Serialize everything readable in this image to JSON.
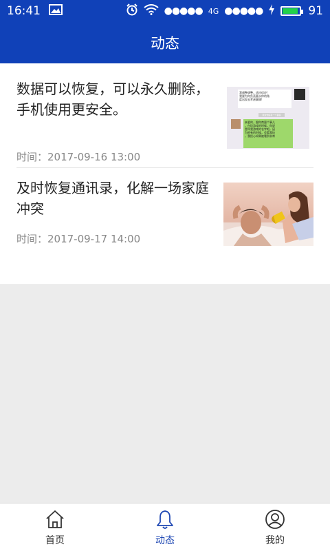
{
  "status_bar": {
    "time": "16:41",
    "network": "4G",
    "battery": "91",
    "battery_level": 0.91,
    "icons": [
      "image-icon",
      "alarm-icon",
      "wifi-icon",
      "signal-icon",
      "charging-icon",
      "battery-icon"
    ]
  },
  "header": {
    "title": "动态"
  },
  "feed": {
    "items": [
      {
        "title": "数据可以恢复，可以永久删除，手机使用更安全。",
        "time": "时间：2017-09-16 13:00",
        "thumb": {
          "bubble_top": "我调整调整，适应适应!\n我要为你负责要从你的角\n度出发去考虑事情!",
          "bubble_mid": "我对你好有一个事情",
          "bubble_green": "亲爱的，跟你商量个事儿\n，在玩游戏的时候，你说\n是叫我游戏的名字吧，因\n为他有的时候，会看我玩\n，我担心如果被看到非常"
        }
      },
      {
        "title": "及时恢复通讯录，化解一场家庭冲突",
        "time": "时间：2017-09-17 14:00"
      }
    ]
  },
  "tabbar": {
    "tabs": [
      {
        "label": "首页",
        "icon": "home-icon"
      },
      {
        "label": "动态",
        "icon": "bell-icon",
        "active": true
      },
      {
        "label": "我的",
        "icon": "user-icon"
      }
    ],
    "active_color": "#1e47b3"
  },
  "colors": {
    "primary": "#1041b8",
    "battery_green": "#23d14a"
  }
}
